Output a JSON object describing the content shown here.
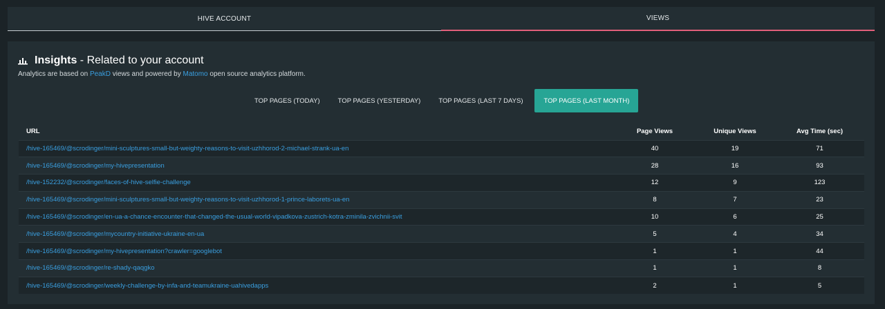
{
  "tabs": [
    {
      "label": "HIVE ACCOUNT",
      "active": false
    },
    {
      "label": "VIEWS",
      "active": true
    }
  ],
  "insights": {
    "title_bold": "Insights",
    "title_rest": " - Related to your account",
    "subtitle": {
      "part1": "Analytics are based on ",
      "link1": "PeakD",
      "part2": " views and powered by ",
      "link2": "Matomo",
      "part3": " open source analytics platform."
    }
  },
  "period_tabs": [
    {
      "label": "TOP PAGES (TODAY)",
      "active": false
    },
    {
      "label": "TOP PAGES (YESTERDAY)",
      "active": false
    },
    {
      "label": "TOP PAGES (LAST 7 DAYS)",
      "active": false
    },
    {
      "label": "TOP PAGES (LAST MONTH)",
      "active": true
    }
  ],
  "table": {
    "headers": [
      "URL",
      "Page Views",
      "Unique Views",
      "Avg Time (sec)"
    ],
    "rows": [
      [
        "/hive-165469/@scrodinger/mini-sculptures-small-but-weighty-reasons-to-visit-uzhhorod-2-michael-strank-ua-en",
        "40",
        "19",
        "71"
      ],
      [
        "/hive-165469/@scrodinger/my-hivepresentation",
        "28",
        "16",
        "93"
      ],
      [
        "/hive-152232/@scrodinger/faces-of-hive-selfie-challenge",
        "12",
        "9",
        "123"
      ],
      [
        "/hive-165469/@scrodinger/mini-sculptures-small-but-weighty-reasons-to-visit-uzhhorod-1-prince-laborets-ua-en",
        "8",
        "7",
        "23"
      ],
      [
        "/hive-165469/@scrodinger/en-ua-a-chance-encounter-that-changed-the-usual-world-vipadkova-zustrich-kotra-zminila-zvichnii-svit",
        "10",
        "6",
        "25"
      ],
      [
        "/hive-165469/@scrodinger/mycountry-initiative-ukraine-en-ua",
        "5",
        "4",
        "34"
      ],
      [
        "/hive-165469/@scrodinger/my-hivepresentation?crawler=googlebot",
        "1",
        "1",
        "44"
      ],
      [
        "/hive-165469/@scrodinger/re-shady-qaqgko",
        "1",
        "1",
        "8"
      ],
      [
        "/hive-165469/@scrodinger/weekly-challenge-by-infa-and-teamukraine-uahivedapps",
        "2",
        "1",
        "5"
      ]
    ]
  },
  "colors": {
    "accent_tab_underline": "#e05f7a",
    "active_period": "#27a595",
    "link": "#3a9fe0"
  }
}
